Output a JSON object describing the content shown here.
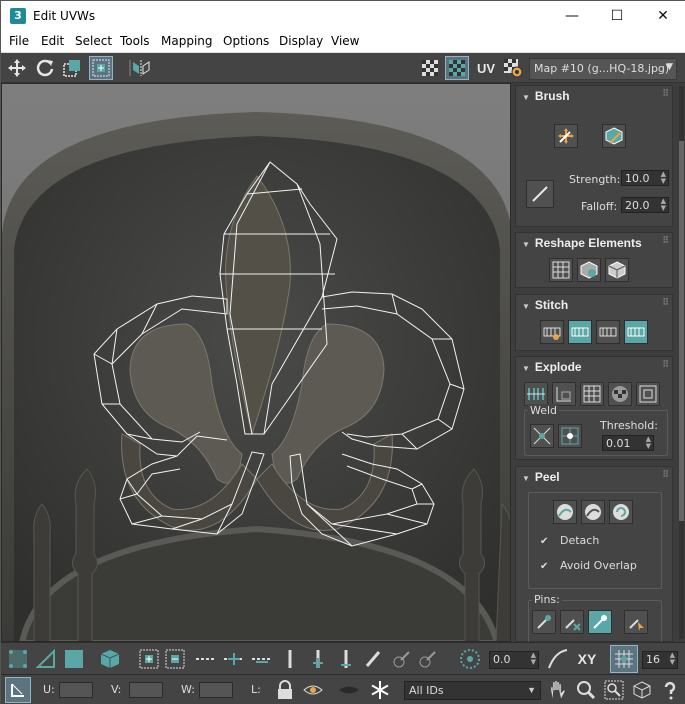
{
  "window": {
    "app_icon_text": "3",
    "title": "Edit UVWs",
    "minimize": "—",
    "maximize": "☐",
    "close": "✕"
  },
  "menus": [
    "File",
    "Edit",
    "Select",
    "Tools",
    "Mapping",
    "Options",
    "Display",
    "View"
  ],
  "toolbar": {
    "uv_label": "UV",
    "map_select": "Map #10 (g...HQ-18.jpg)"
  },
  "brush": {
    "title": "Brush",
    "strength_label": "Strength:",
    "strength_value": "10.0",
    "falloff_label": "Falloff:",
    "falloff_value": "20.0"
  },
  "reshape": {
    "title": "Reshape Elements"
  },
  "stitch": {
    "title": "Stitch"
  },
  "explode": {
    "title": "Explode",
    "weld_label": "Weld",
    "threshold_label": "Threshold:",
    "threshold_value": "0.01"
  },
  "peel": {
    "title": "Peel",
    "detach_label": "Detach",
    "detach_checked": true,
    "avoid_overlap_label": "Avoid Overlap",
    "avoid_overlap_checked": true,
    "pins_label": "Pins:"
  },
  "bottom": {
    "angle_value": "0.0",
    "xy_label": "XY",
    "grid_value": "16",
    "u_label": "U:",
    "v_label": "V:",
    "w_label": "W:",
    "l_label": "L:",
    "ids_select": "All IDs"
  },
  "colors": {
    "accent_teal": "#5aa7a8",
    "panel_bg": "#444444",
    "selection_highlight": "#5c7380"
  }
}
